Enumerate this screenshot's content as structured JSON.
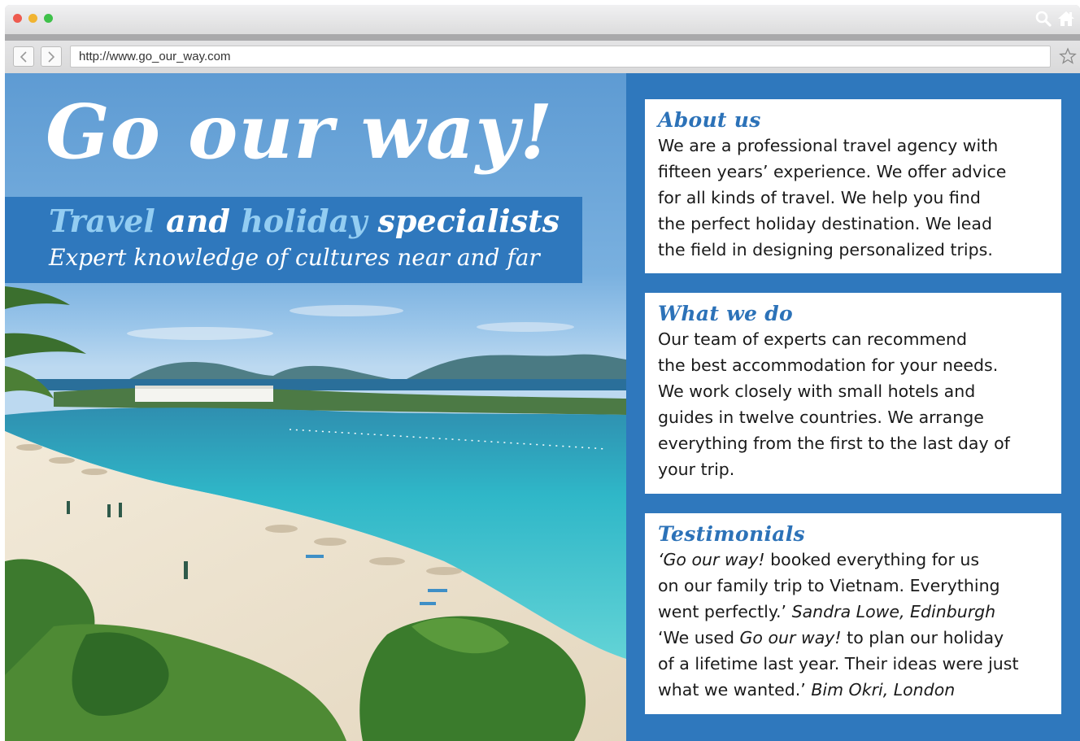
{
  "browser": {
    "url": "http://www.go_our_way.com",
    "icons": [
      "search-icon",
      "home-icon",
      "back-arrow-icon",
      "forward-arrow-icon",
      "star-icon"
    ],
    "colors": {
      "close": "#ee5b4f",
      "minimize": "#f1b431",
      "zoom": "#3fc14a"
    }
  },
  "hero": {
    "title": "Go our way!",
    "tagline": {
      "word1": "Travel",
      "word2": "and",
      "word3": "holiday",
      "word4": "specialists"
    },
    "subtagline": "Expert knowledge of cultures near and far"
  },
  "sections": {
    "about": {
      "heading": "About us",
      "lines": [
        "We are a professional travel agency with",
        "fifteen years’ experience. We offer advice",
        "for all kinds of travel. We help you find",
        "the perfect holiday destination. We lead",
        "the field in designing personalized trips."
      ]
    },
    "whatwedo": {
      "heading": "What we do",
      "lines": [
        "Our team of experts can recommend",
        "the best accommodation for your needs.",
        "We work closely with small hotels and",
        "guides in twelve countries. We arrange",
        "everything from the first to the last day of",
        "your trip."
      ]
    },
    "testimonials": {
      "heading": "Testimonials",
      "t1": {
        "q_open": "‘",
        "brand": "Go our way!",
        "text1": " booked everything for us",
        "line2": "on our family trip to Vietnam. Everything",
        "line3": "went perfectly.’ ",
        "author": "Sandra Lowe, Edinburgh"
      },
      "t2": {
        "text_a": "‘We used ",
        "brand": "Go our way!",
        "text_b": " to plan our holiday",
        "line2": "of a lifetime last year. Their ideas were just",
        "line3": "what we wanted.’ ",
        "author": "Bim Okri, London"
      }
    }
  },
  "theme": {
    "panel_blue": "#2f78bd",
    "heading_blue": "#2c72b8",
    "highlight_blue": "#93cdf2"
  }
}
